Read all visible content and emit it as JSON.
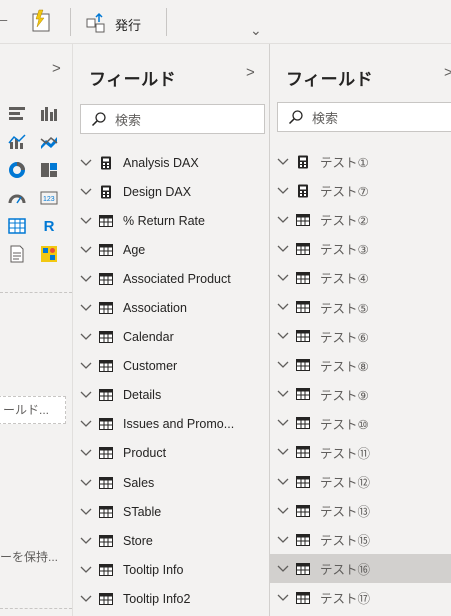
{
  "ribbon": {
    "publish_label": "発行",
    "dash_glyph": "–",
    "collapse_glyph": "⌄"
  },
  "left_panel": {
    "expand_glyph": ">",
    "r_visual_label": "R",
    "field_well_text": "ールド...",
    "keep_text": "ーを保持..."
  },
  "fields_pane": {
    "title": "フィールド",
    "collapse_glyph": ">",
    "search_placeholder": "検索",
    "items": [
      {
        "label": "Analysis DAX",
        "icon": "measure-table-icon"
      },
      {
        "label": "Design DAX",
        "icon": "measure-table-icon"
      },
      {
        "label": "% Return Rate",
        "icon": "table-icon"
      },
      {
        "label": "Age",
        "icon": "table-icon"
      },
      {
        "label": "Associated Product",
        "icon": "table-icon"
      },
      {
        "label": "Association",
        "icon": "table-icon"
      },
      {
        "label": "Calendar",
        "icon": "table-icon"
      },
      {
        "label": "Customer",
        "icon": "table-icon"
      },
      {
        "label": "Details",
        "icon": "table-icon"
      },
      {
        "label": "Issues and Promo...",
        "icon": "table-icon"
      },
      {
        "label": "Product",
        "icon": "table-icon"
      },
      {
        "label": "Sales",
        "icon": "table-icon"
      },
      {
        "label": "STable",
        "icon": "table-icon"
      },
      {
        "label": "Store",
        "icon": "table-icon"
      },
      {
        "label": "Tooltip Info",
        "icon": "table-icon"
      },
      {
        "label": "Tooltip Info2",
        "icon": "table-icon"
      }
    ]
  },
  "fields_pane_2": {
    "title": "フィールド",
    "collapse_glyph": ">",
    "search_placeholder": "検索",
    "items": [
      {
        "label": "テスト①",
        "icon": "measure-table-icon"
      },
      {
        "label": "テスト⑦",
        "icon": "measure-table-icon"
      },
      {
        "label": "テスト②",
        "icon": "table-icon"
      },
      {
        "label": "テスト③",
        "icon": "table-icon"
      },
      {
        "label": "テスト④",
        "icon": "table-icon"
      },
      {
        "label": "テスト⑤",
        "icon": "table-icon"
      },
      {
        "label": "テスト⑥",
        "icon": "table-icon"
      },
      {
        "label": "テスト⑧",
        "icon": "table-icon"
      },
      {
        "label": "テスト⑨",
        "icon": "table-icon"
      },
      {
        "label": "テスト⑩",
        "icon": "table-icon"
      },
      {
        "label": "テスト⑪",
        "icon": "table-icon"
      },
      {
        "label": "テスト⑫",
        "icon": "table-icon"
      },
      {
        "label": "テスト⑬",
        "icon": "table-icon"
      },
      {
        "label": "テスト⑮",
        "icon": "table-icon"
      },
      {
        "label": "テスト⑯",
        "icon": "table-icon",
        "selected": true
      },
      {
        "label": "テスト⑰",
        "icon": "table-icon"
      }
    ]
  },
  "colors": {
    "pane_bg": "#f3f2f1",
    "selected_row": "#d2d0ce",
    "accent_blue": "#0078d4",
    "accent_yellow": "#f2c811"
  }
}
